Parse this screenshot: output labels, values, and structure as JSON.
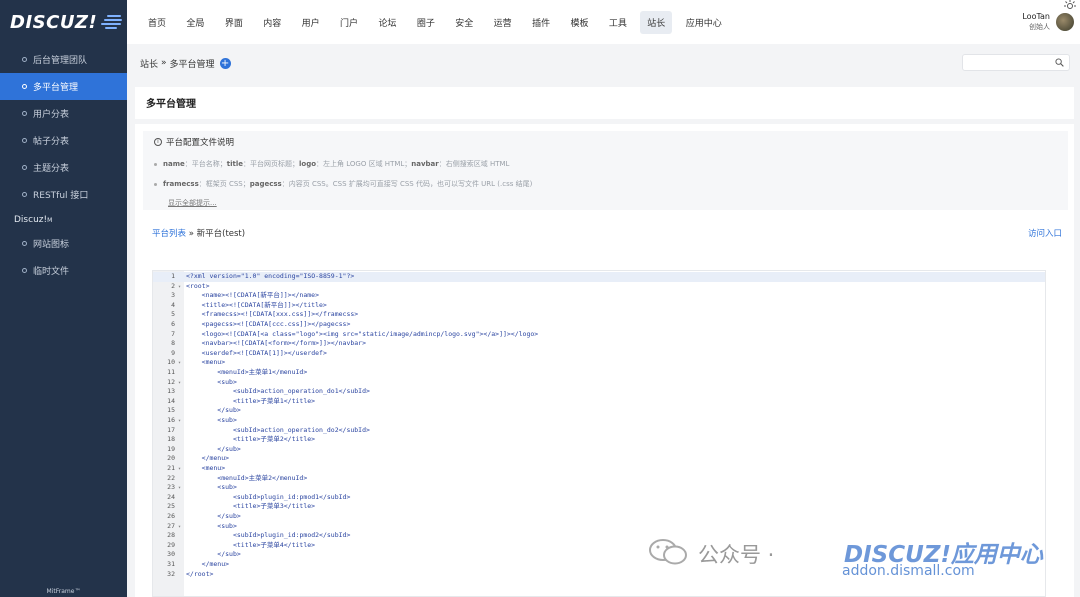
{
  "sidebar": {
    "logo": "DISCUZ!",
    "items": [
      {
        "label": "后台管理团队",
        "active": false
      },
      {
        "label": "多平台管理",
        "active": true
      },
      {
        "label": "用户分表",
        "active": false
      },
      {
        "label": "帖子分表",
        "active": false
      },
      {
        "label": "主题分表",
        "active": false
      },
      {
        "label": "RESTful 接口",
        "active": false
      }
    ],
    "group": "Discuz!",
    "group_sup": "M",
    "group_items": [
      {
        "label": "网站图标"
      },
      {
        "label": "临时文件"
      }
    ],
    "footer": "MitFrame™"
  },
  "topnav": {
    "items": [
      "首页",
      "全局",
      "界面",
      "内容",
      "用户",
      "门户",
      "论坛",
      "圈子",
      "安全",
      "运营",
      "插件",
      "模板",
      "工具",
      "站长",
      "应用中心"
    ],
    "active_index": 13
  },
  "user": {
    "name": "LooTan",
    "role": "创始人"
  },
  "breadcrumb": {
    "root": "站长",
    "sep": "»",
    "current": "多平台管理",
    "add_symbol": "+"
  },
  "page": {
    "title": "多平台管理"
  },
  "notice": {
    "heading": "平台配置文件说明",
    "lines": [
      [
        {
          "k": "name",
          "v": "：平台名称；"
        },
        {
          "k": "title",
          "v": "：平台网页标题；"
        },
        {
          "k": "logo",
          "v": "：左上角 LOGO 区域 HTML；"
        },
        {
          "k": "navbar",
          "v": "：右侧搜索区域 HTML"
        }
      ],
      [
        {
          "k": "framecss",
          "v": "：框架页 CSS；"
        },
        {
          "k": "pagecss",
          "v": "：内容页 CSS。CSS 扩展均可直接写 CSS 代码，也可以写文件 URL (.css 结尾)"
        }
      ]
    ],
    "show_all": "显示全部提示..."
  },
  "subcrumb": {
    "link": "平台列表",
    "sep": " » ",
    "current": "新平台(test)"
  },
  "visit_link": "访问入口",
  "code": [
    {
      "n": "1",
      "f": "",
      "t": "<?xml version=\"1.0\" encoding=\"ISO-8859-1\"?>"
    },
    {
      "n": "2",
      "f": "▾",
      "t": "<root>"
    },
    {
      "n": "3",
      "f": "",
      "t": "    <name><![CDATA[新平台]]></name>"
    },
    {
      "n": "4",
      "f": "",
      "t": "    <title><![CDATA[新平台]]></title>"
    },
    {
      "n": "5",
      "f": "",
      "t": "    <framecss><![CDATA[xxx.css]]></framecss>"
    },
    {
      "n": "6",
      "f": "",
      "t": "    <pagecss><![CDATA[ccc.css]]></pagecss>"
    },
    {
      "n": "7",
      "f": "",
      "t": "    <logo><![CDATA[<a class=\"logo\"><img src=\"static/image/admincp/logo.svg\"></a>]]></logo>"
    },
    {
      "n": "8",
      "f": "",
      "t": "    <navbar><![CDATA[<form></form>]]></navbar>"
    },
    {
      "n": "9",
      "f": "",
      "t": "    <userdef><![CDATA[1]]></userdef>"
    },
    {
      "n": "10",
      "f": "▾",
      "t": "    <menu>"
    },
    {
      "n": "11",
      "f": "",
      "t": "        <menuId>主菜单1</menuId>"
    },
    {
      "n": "12",
      "f": "▾",
      "t": "        <sub>"
    },
    {
      "n": "13",
      "f": "",
      "t": "            <subId>action_operation_do1</subId>"
    },
    {
      "n": "14",
      "f": "",
      "t": "            <title>子菜单1</title>"
    },
    {
      "n": "15",
      "f": "",
      "t": "        </sub>"
    },
    {
      "n": "16",
      "f": "▾",
      "t": "        <sub>"
    },
    {
      "n": "17",
      "f": "",
      "t": "            <subId>action_operation_do2</subId>"
    },
    {
      "n": "18",
      "f": "",
      "t": "            <title>子菜单2</title>"
    },
    {
      "n": "19",
      "f": "",
      "t": "        </sub>"
    },
    {
      "n": "20",
      "f": "",
      "t": "    </menu>"
    },
    {
      "n": "21",
      "f": "▾",
      "t": "    <menu>"
    },
    {
      "n": "22",
      "f": "",
      "t": "        <menuId>主菜单2</menuId>"
    },
    {
      "n": "23",
      "f": "▾",
      "t": "        <sub>"
    },
    {
      "n": "24",
      "f": "",
      "t": "            <subId>plugin_id:pmod1</subId>"
    },
    {
      "n": "25",
      "f": "",
      "t": "            <title>子菜单3</title>"
    },
    {
      "n": "26",
      "f": "",
      "t": "        </sub>"
    },
    {
      "n": "27",
      "f": "▾",
      "t": "        <sub>"
    },
    {
      "n": "28",
      "f": "",
      "t": "            <subId>plugin_id:pmod2</subId>"
    },
    {
      "n": "29",
      "f": "",
      "t": "            <title>子菜单4</title>"
    },
    {
      "n": "30",
      "f": "",
      "t": "        </sub>"
    },
    {
      "n": "31",
      "f": "",
      "t": "    </menu>"
    },
    {
      "n": "32",
      "f": "",
      "t": "</root>"
    }
  ],
  "watermark": {
    "text": "公众号 · ",
    "brand": "DISCUZ!应用中心",
    "url": "addon.dismall.com"
  },
  "colors": {
    "sidebar": "#23334a",
    "accent": "#2f73d9",
    "code": "#2a44a0"
  },
  "icons": {
    "add": "plus-circle-icon",
    "search": "search-icon",
    "info": "info-icon",
    "theme": "sun-icon",
    "wechat": "wechat-icon"
  }
}
